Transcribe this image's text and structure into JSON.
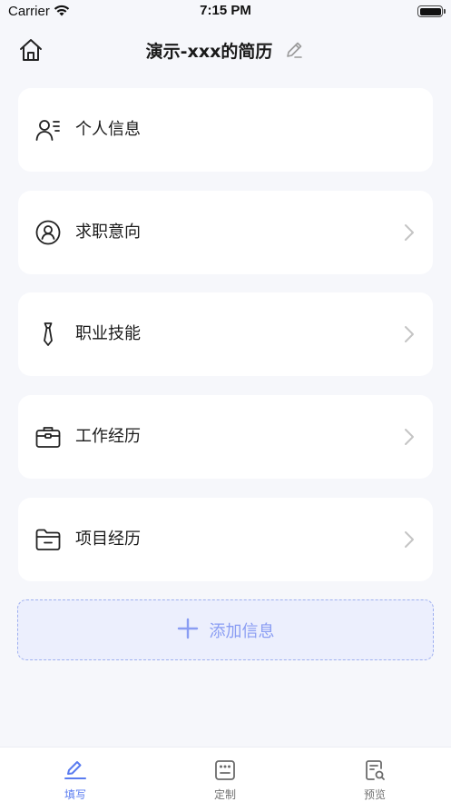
{
  "status_bar": {
    "carrier": "Carrier",
    "time": "7:15 PM"
  },
  "header": {
    "title": "演示-xxx的简历",
    "home_icon": "home-icon",
    "edit_icon": "pencil-icon"
  },
  "sections": [
    {
      "label": "个人信息",
      "icon": "person-info-icon",
      "has_chevron": false
    },
    {
      "label": "求职意向",
      "icon": "user-circle-icon",
      "has_chevron": true
    },
    {
      "label": "职业技能",
      "icon": "tie-icon",
      "has_chevron": true
    },
    {
      "label": "工作经历",
      "icon": "briefcase-icon",
      "has_chevron": true
    },
    {
      "label": "项目经历",
      "icon": "folder-icon",
      "has_chevron": true
    }
  ],
  "add_section": {
    "label": "添加信息",
    "icon": "plus-icon"
  },
  "tabs": [
    {
      "label": "填写",
      "icon": "pen-icon",
      "active": true
    },
    {
      "label": "定制",
      "icon": "template-icon",
      "active": false
    },
    {
      "label": "预览",
      "icon": "preview-icon",
      "active": false
    }
  ],
  "colors": {
    "accent": "#5a7cf0",
    "add_bg": "#eceffd",
    "add_text": "#8a9df3",
    "page_bg": "#f6f7fb"
  }
}
